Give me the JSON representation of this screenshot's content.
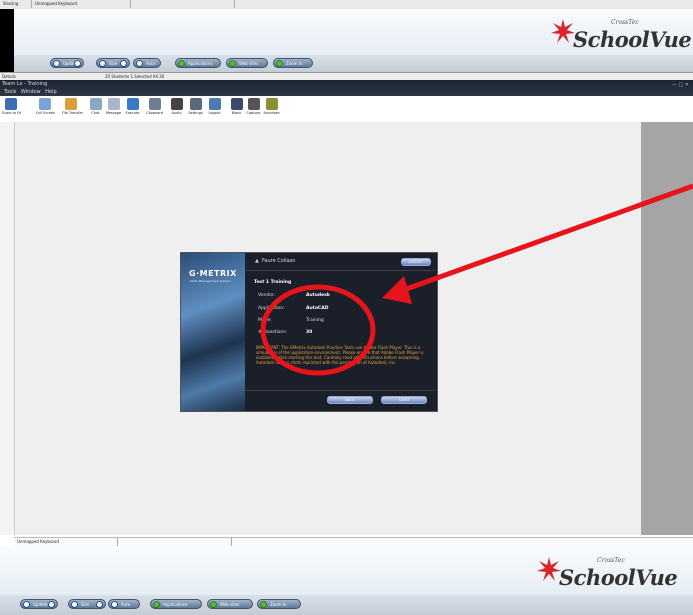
{
  "top_status": {
    "cell1": "Sharing",
    "cell2": "Unmapped Keyboard"
  },
  "brand": {
    "name": "SchoolVue",
    "maker": "CrossTec"
  },
  "control_bar": {
    "update": "Update",
    "size": "Size",
    "auto": "Auto",
    "applications": "Applications",
    "web_sites": "Web sites",
    "zoom": "Zoom In"
  },
  "student_bar": {
    "left": "Details",
    "counts": "20 Students  1 Selected  All  30"
  },
  "window": {
    "title": "Team Lx - Training"
  },
  "menu": {
    "items": [
      "Tools",
      "Window",
      "Help"
    ]
  },
  "toolbar": {
    "tools": [
      {
        "label": "Scale to Fit",
        "icon": "scale-to-fit-icon",
        "color": "#3a6fb5"
      },
      {
        "label": "Full Screen",
        "icon": "full-screen-icon",
        "color": "#7aa3d6"
      },
      {
        "label": "File Transfer",
        "icon": "file-transfer-icon",
        "color": "#d8a03a"
      },
      {
        "label": "Chat",
        "icon": "chat-icon",
        "color": "#8aa6c9"
      },
      {
        "label": "Message",
        "icon": "message-icon",
        "color": "#a7b7cc"
      },
      {
        "label": "Execute",
        "icon": "execute-icon",
        "color": "#3a78c9"
      },
      {
        "label": "Clipboard",
        "icon": "clipboard-icon",
        "color": "#6e7e92"
      },
      {
        "label": "Audio",
        "icon": "audio-icon",
        "color": "#444444"
      },
      {
        "label": "Settings",
        "icon": "settings-icon",
        "color": "#5a6a7c"
      },
      {
        "label": "Logout",
        "icon": "logout-icon",
        "color": "#4d7bb0"
      },
      {
        "label": "Blank",
        "icon": "blank-icon",
        "color": "#3a4a6a"
      },
      {
        "label": "Capture",
        "icon": "capture-icon",
        "color": "#555555"
      },
      {
        "label": "Annotate",
        "icon": "annotate-icon",
        "color": "#8b8f3a"
      }
    ]
  },
  "dialog": {
    "logo": "G·METRIX",
    "logo_sub": "Skills Management System",
    "user": "Faure Collazo",
    "header_btn": "LOGOUT",
    "test_title": "Test 1 Training",
    "rows": [
      {
        "label": "Vendor:",
        "value": "Autodesk"
      },
      {
        "label": "Application:",
        "value": "AutoCAD"
      },
      {
        "label": "Mode:",
        "value": "Training"
      },
      {
        "label": "# Questions:",
        "value": "30"
      }
    ],
    "notice": "IMPORTANT: The GMetrix Autodesk Practice Tests use Adobe Flash Player. This is a simulation of the application environment. Please ensure that Adobe Flash Player is installed before starting this test. Carefully read all instructions before answering. Autodesk screen shots reprinted with the permission of Autodesk, Inc.",
    "back": "BACK",
    "start": "START"
  },
  "bottom_status": {
    "cell1": "Unmapped Keyboard"
  },
  "colors": {
    "annotation": "#e8141c",
    "dialog_notice": "#e8a33a",
    "side_panel": "#a5a5a5"
  }
}
